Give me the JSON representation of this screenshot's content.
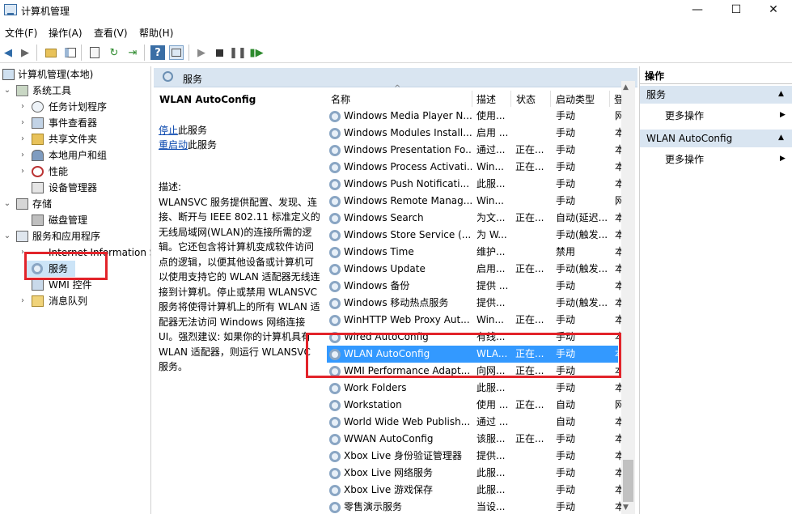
{
  "window": {
    "title": "计算机管理",
    "min": "—",
    "max": "☐",
    "close": "✕"
  },
  "menu": [
    "文件(F)",
    "操作(A)",
    "查看(V)",
    "帮助(H)"
  ],
  "tree": {
    "root": "计算机管理(本地)",
    "system_tools": "系统工具",
    "task_scheduler": "任务计划程序",
    "event_viewer": "事件查看器",
    "shared_folders": "共享文件夹",
    "local_users": "本地用户和组",
    "performance": "性能",
    "device_manager": "设备管理器",
    "storage": "存储",
    "disk_mgmt": "磁盘管理",
    "services_apps": "服务和应用程序",
    "iis": "Internet Information S",
    "services": "服务",
    "wmi": "WMI 控件",
    "msmq": "消息队列"
  },
  "middle": {
    "header": "服务",
    "selected_name": "WLAN AutoConfig",
    "stop_link": "停止",
    "stop_suffix": "此服务",
    "restart_link": "重启动",
    "restart_suffix": "此服务",
    "desc_label": "描述:",
    "desc_text": "WLANSVC 服务提供配置、发现、连接、断开与 IEEE 802.11 标准定义的无线局域网(WLAN)的连接所需的逻辑。它还包含将计算机变成软件访问点的逻辑，以便其他设备或计算机可以使用支持它的 WLAN 适配器无线连接到计算机。停止或禁用 WLANSVC 服务将使得计算机上的所有 WLAN 适配器无法访问 Windows 网络连接 UI。强烈建议: 如果你的计算机具有 WLAN 适配器，则运行 WLANSVC 服务。"
  },
  "columns": [
    "名称",
    "描述",
    "状态",
    "启动类型",
    "登"
  ],
  "services": [
    {
      "name": "Windows Media Player N...",
      "desc": "使用...",
      "state": "",
      "start": "手动",
      "login": "网"
    },
    {
      "name": "Windows Modules Install...",
      "desc": "启用 ...",
      "state": "",
      "start": "手动",
      "login": "本"
    },
    {
      "name": "Windows Presentation Fo...",
      "desc": "通过...",
      "state": "正在...",
      "start": "手动",
      "login": "本"
    },
    {
      "name": "Windows Process Activati...",
      "desc": "Win...",
      "state": "正在...",
      "start": "手动",
      "login": "本"
    },
    {
      "name": "Windows Push Notificati...",
      "desc": "此服...",
      "state": "",
      "start": "手动",
      "login": "本"
    },
    {
      "name": "Windows Remote Manag...",
      "desc": "Win...",
      "state": "",
      "start": "手动",
      "login": "网"
    },
    {
      "name": "Windows Search",
      "desc": "为文...",
      "state": "正在...",
      "start": "自动(延迟...",
      "login": "本"
    },
    {
      "name": "Windows Store Service (...",
      "desc": "为 W...",
      "state": "",
      "start": "手动(触发...",
      "login": "本"
    },
    {
      "name": "Windows Time",
      "desc": "维护...",
      "state": "",
      "start": "禁用",
      "login": "本"
    },
    {
      "name": "Windows Update",
      "desc": "启用...",
      "state": "正在...",
      "start": "手动(触发...",
      "login": "本"
    },
    {
      "name": "Windows 备份",
      "desc": "提供 ...",
      "state": "",
      "start": "手动",
      "login": "本"
    },
    {
      "name": "Windows 移动热点服务",
      "desc": "提供...",
      "state": "",
      "start": "手动(触发...",
      "login": "本"
    },
    {
      "name": "WinHTTP Web Proxy Aut...",
      "desc": "Win...",
      "state": "正在...",
      "start": "手动",
      "login": "本"
    },
    {
      "name": "Wired AutoConfig",
      "desc": "有线...",
      "state": "",
      "start": "手动",
      "login": "本"
    },
    {
      "name": "WLAN AutoConfig",
      "desc": "WLA...",
      "state": "正在...",
      "start": "手动",
      "login": "本"
    },
    {
      "name": "WMI Performance Adapt...",
      "desc": "向网...",
      "state": "正在...",
      "start": "手动",
      "login": "本"
    },
    {
      "name": "Work Folders",
      "desc": "此服...",
      "state": "",
      "start": "手动",
      "login": "本"
    },
    {
      "name": "Workstation",
      "desc": "使用 ...",
      "state": "正在...",
      "start": "自动",
      "login": "网"
    },
    {
      "name": "World Wide Web Publish...",
      "desc": "通过 ...",
      "state": "",
      "start": "自动",
      "login": "本"
    },
    {
      "name": "WWAN AutoConfig",
      "desc": "该服...",
      "state": "正在...",
      "start": "手动",
      "login": "本"
    },
    {
      "name": "Xbox Live 身份验证管理器",
      "desc": "提供...",
      "state": "",
      "start": "手动",
      "login": "本"
    },
    {
      "name": "Xbox Live 网络服务",
      "desc": "此服...",
      "state": "",
      "start": "手动",
      "login": "本"
    },
    {
      "name": "Xbox Live 游戏保存",
      "desc": "此服...",
      "state": "",
      "start": "手动",
      "login": "本"
    },
    {
      "name": "零售演示服务",
      "desc": "当设...",
      "state": "",
      "start": "手动",
      "login": "本"
    }
  ],
  "selected_service_index": 14,
  "actions": {
    "title": "操作",
    "section1": "服务",
    "more1": "更多操作",
    "section2": "WLAN AutoConfig",
    "more2": "更多操作"
  },
  "colors": {
    "selection": "#3399ff",
    "highlight_box": "#e2232a",
    "header_bg": "#d9e5f1"
  }
}
